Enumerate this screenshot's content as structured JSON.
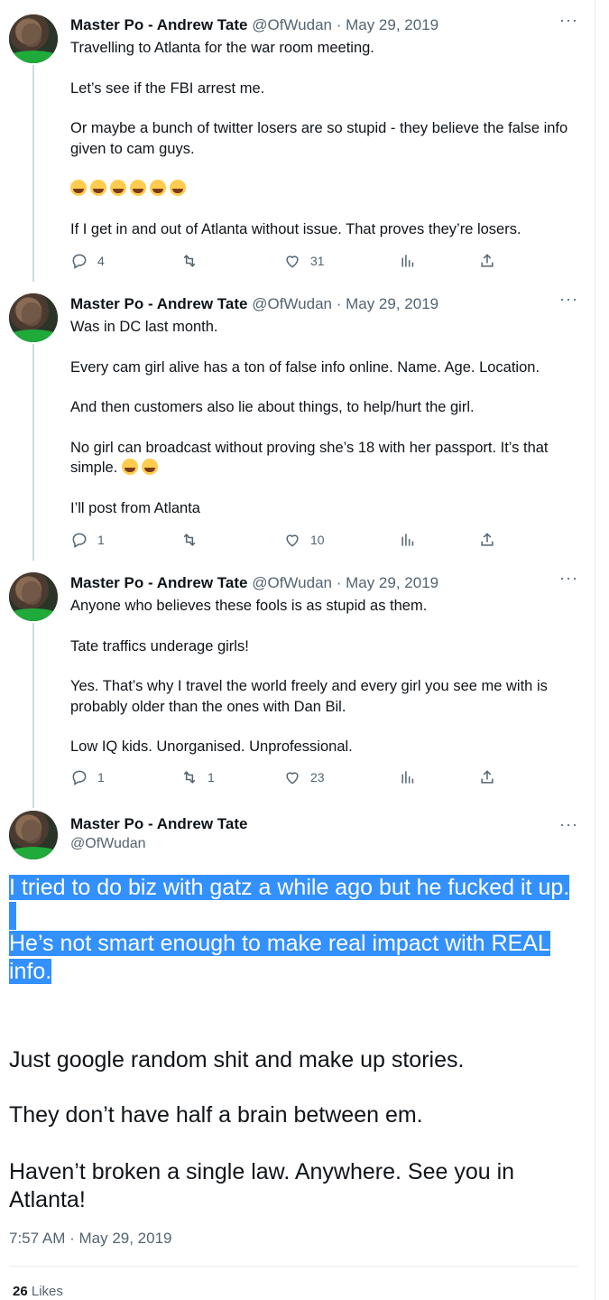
{
  "author": {
    "name": "Master Po - Andrew Tate",
    "handle": "@OfWudan"
  },
  "more_glyph": "···",
  "thread": [
    {
      "meta": "@OfWudan · May 29, 2019",
      "paragraphs": [
        "Travelling to Atlanta for the war room meeting.",
        "Let’s see if the FBI arrest me.",
        "Or maybe a bunch of twitter losers are so stupid - they believe the false info given to cam guys.",
        "",
        "If I get in and out of Atlanta without issue. That proves they’re losers."
      ],
      "emoji_count": 6,
      "replies": "4",
      "retweets": "",
      "likes": "31"
    },
    {
      "meta": "@OfWudan · May 29, 2019",
      "paragraphs": [
        "Was in DC last month.",
        "Every cam girl alive has a ton of false info online. Name. Age. Location.",
        "And then customers also lie about things, to help/hurt the girl.",
        "No girl can broadcast without proving she’s 18 with her passport. It’s that simple.",
        "I’ll post from Atlanta"
      ],
      "replies": "1",
      "retweets": "",
      "likes": "10"
    },
    {
      "meta": "@OfWudan · May 29, 2019",
      "paragraphs": [
        "Anyone who believes these fools is as stupid as them.",
        "Tate traffics underage girls!",
        "Yes. That’s why I travel the world freely and every girl you see me with is probably older than the ones with Dan Bil.",
        "Low IQ kids. Unorganised. Unprofessional."
      ],
      "replies": "1",
      "retweets": "1",
      "likes": "23"
    }
  ],
  "main_tweet": {
    "highlighted": [
      "I tried to do biz with gatz a while ago but he fucked it up.",
      "He’s not smart enough to make real impact with REAL info."
    ],
    "paragraphs": [
      "Just google random shit and make up stories.",
      "They don’t have half a brain between em.",
      "Haven’t broken a single law. Anywhere. See you in Atlanta!"
    ],
    "timestamp": "7:57 AM · May 29, 2019",
    "likes_count": "26",
    "likes_label": "Likes"
  },
  "colors": {
    "highlight": "#3390ff",
    "muted": "#536471",
    "text": "#0f1419"
  }
}
